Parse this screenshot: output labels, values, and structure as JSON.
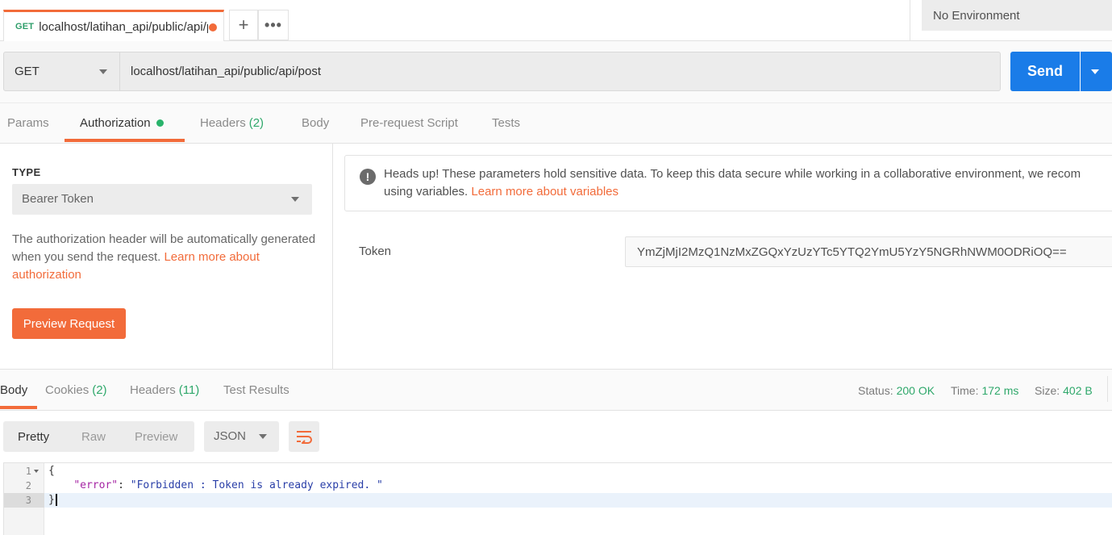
{
  "tabbar": {
    "active_tab": {
      "method": "GET",
      "url": "localhost/latihan_api/public/api/p"
    },
    "plus_label": "+",
    "more_label": "•••",
    "environment": "No Environment"
  },
  "request": {
    "method": "GET",
    "url": "localhost/latihan_api/public/api/post",
    "send_label": "Send"
  },
  "request_tabs": [
    {
      "label": "Params",
      "count": ""
    },
    {
      "label": "Authorization",
      "count": ""
    },
    {
      "label": "Headers",
      "count": "(2)"
    },
    {
      "label": "Body",
      "count": ""
    },
    {
      "label": "Pre-request Script",
      "count": ""
    },
    {
      "label": "Tests",
      "count": ""
    }
  ],
  "auth": {
    "type_label": "TYPE",
    "type_value": "Bearer Token",
    "desc_text": "The authorization header will be automatically generated when you send the request. ",
    "desc_link": "Learn more about authorization",
    "preview_label": "Preview Request",
    "notice_line1": "Heads up! These parameters hold sensitive data. To keep this data secure while working in a collaborative environment, we recom",
    "notice_line2": "using variables. ",
    "notice_link": "Learn more about variables",
    "token_label": "Token",
    "token_value": "YmZjMjI2MzQ1NzMxZGQxYzUzYTc5YTQ2YmU5YzY5NGRhNWM0ODRiOQ=="
  },
  "response_tabs": [
    {
      "label": "Body",
      "count": ""
    },
    {
      "label": "Cookies",
      "count": "(2)"
    },
    {
      "label": "Headers",
      "count": "(11)"
    },
    {
      "label": "Test Results",
      "count": ""
    }
  ],
  "status": {
    "status_label": "Status:",
    "status_value": "200 OK",
    "time_label": "Time:",
    "time_value": "172 ms",
    "size_label": "Size:",
    "size_value": "402 B"
  },
  "view": {
    "modes": [
      "Pretty",
      "Raw",
      "Preview"
    ],
    "format": "JSON"
  },
  "editor": {
    "lines": [
      "1",
      "2",
      "3"
    ],
    "open_brace": "{",
    "key": "\"error\"",
    "colon": ": ",
    "value": "\"Forbidden : Token is already expired. \"",
    "close_brace": "}"
  },
  "colors": {
    "accent": "#f26b3a",
    "primary": "#1a7ce8",
    "success": "#2fa86b"
  }
}
